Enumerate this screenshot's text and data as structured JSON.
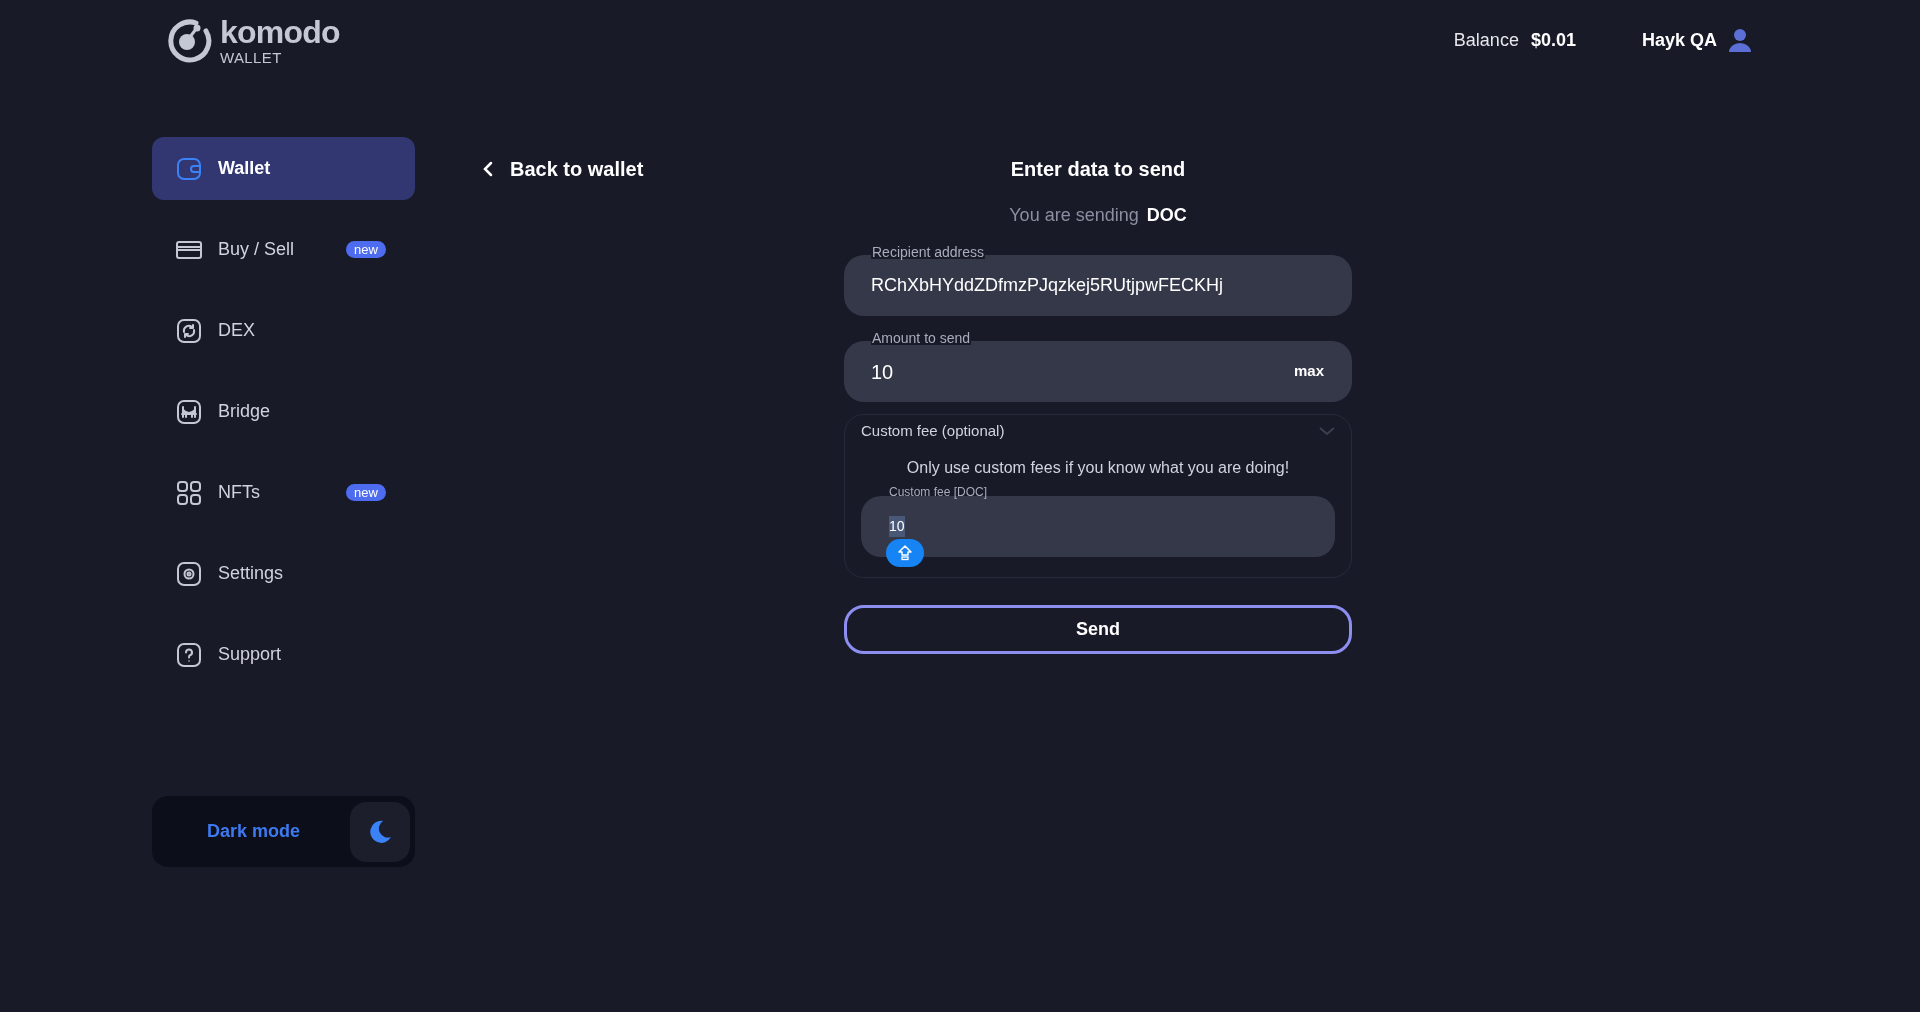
{
  "header": {
    "logo_name": "komodo",
    "logo_sub": "WALLET",
    "balance_label": "Balance",
    "balance_value": "$0.01",
    "user_name": "Hayk QA"
  },
  "sidebar": {
    "items": [
      {
        "label": "Wallet",
        "selected": true
      },
      {
        "label": "Buy / Sell",
        "selected": false,
        "badge": "new"
      },
      {
        "label": "DEX",
        "selected": false
      },
      {
        "label": "Bridge",
        "selected": false
      },
      {
        "label": "NFTs",
        "selected": false,
        "badge": "new"
      },
      {
        "label": "Settings",
        "selected": false
      },
      {
        "label": "Support",
        "selected": false
      }
    ],
    "dark_mode": {
      "label": "Dark mode",
      "on": true
    }
  },
  "back_link": "Back to wallet",
  "form": {
    "title": "Enter data to send",
    "sending_label": "You are sending",
    "coin": "DOC",
    "recipient": {
      "label": "Recipient address",
      "value": "RChXbHYddZDfmzPJqzkej5RUtjpwFECKHj"
    },
    "amount": {
      "label": "Amount to send",
      "value": "10",
      "max": "max"
    },
    "custom_fee": {
      "title": "Custom fee (optional)",
      "expanded": true,
      "warning": "Only use custom fees if you know what you are doing!",
      "field_label": "Custom fee [DOC]",
      "value": "10"
    },
    "send": "Send"
  }
}
